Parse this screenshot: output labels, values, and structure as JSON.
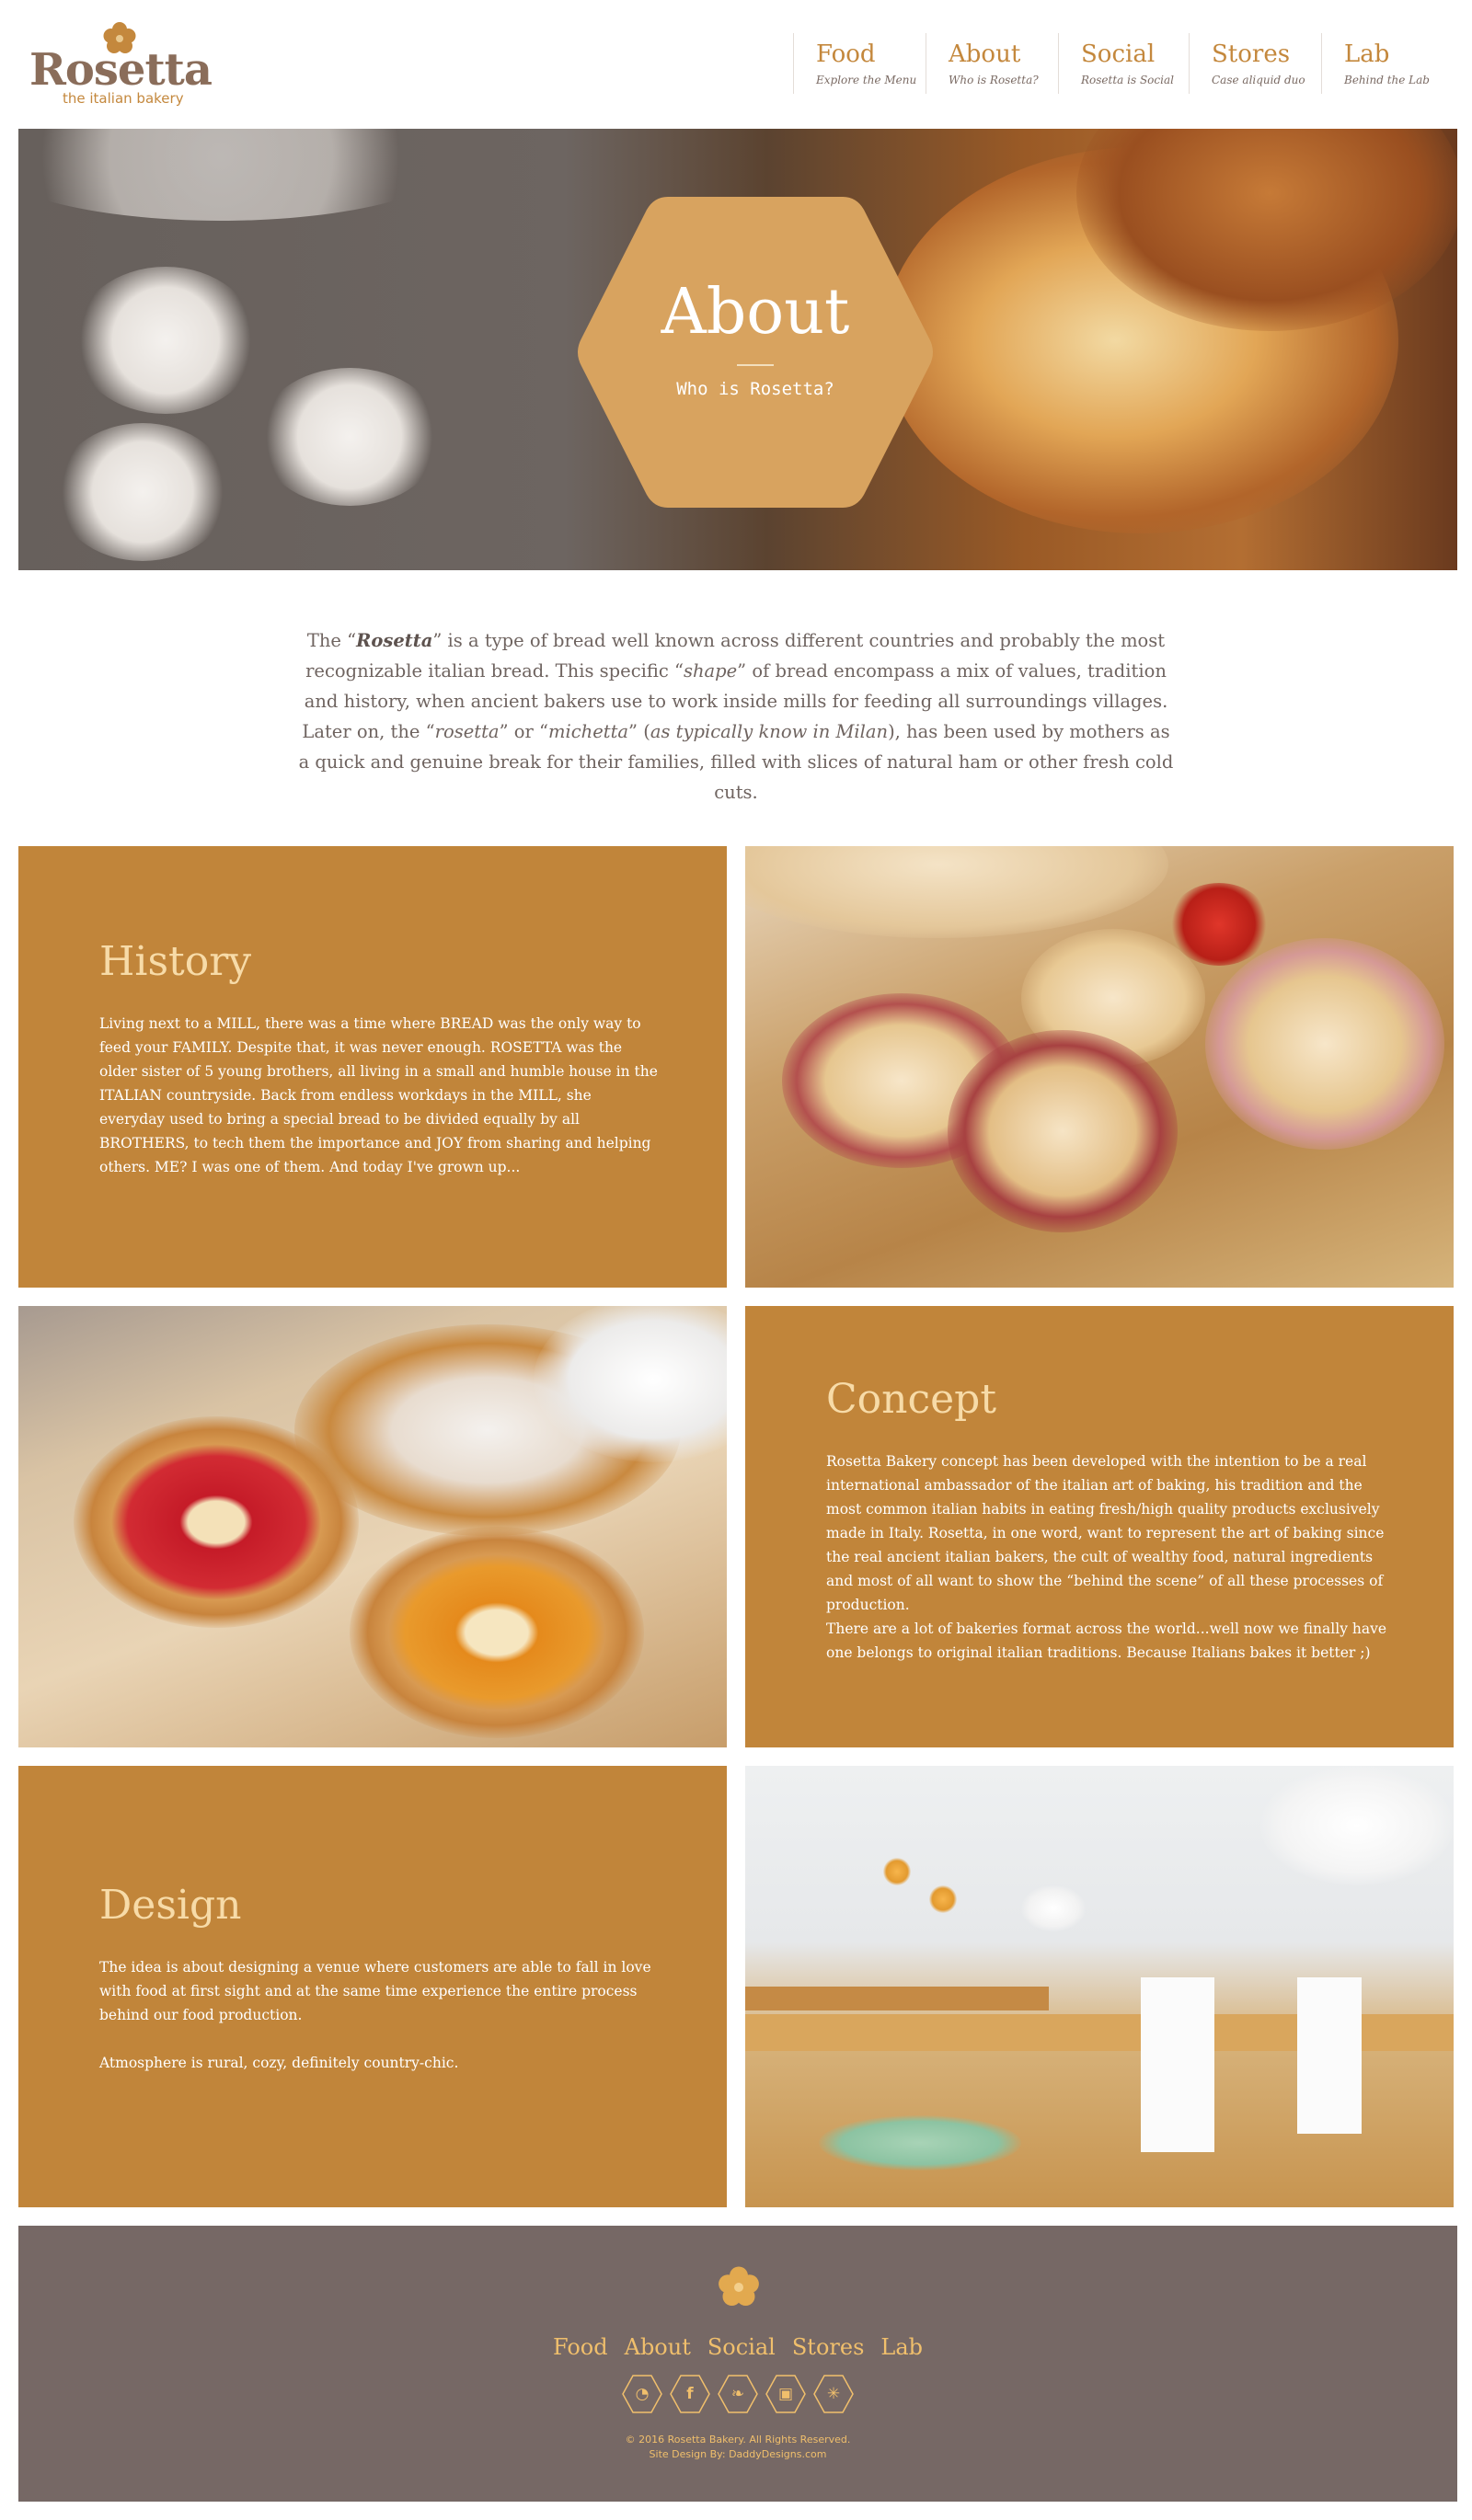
{
  "brand": {
    "name": "Rosetta",
    "tagline": "the italian bakery",
    "accent": "#c1853a",
    "title_color": "#f7dba8",
    "footer_bg": "#766865"
  },
  "nav": [
    {
      "label": "Food",
      "sub": "Explore the Menu"
    },
    {
      "label": "About",
      "sub": "Who is Rosetta?"
    },
    {
      "label": "Social",
      "sub": "Rosetta is Social"
    },
    {
      "label": "Stores",
      "sub": "Case aliquid duo"
    },
    {
      "label": "Lab",
      "sub": "Behind the Lab"
    }
  ],
  "hero": {
    "title": "About",
    "subtitle": "Who is Rosetta?"
  },
  "intro": {
    "p1": "The “",
    "rosetta": "Rosetta",
    "p2": "” is a type of bread well known across different countries and probably the most recognizable italian bread. This specific “",
    "shape": "shape",
    "p3": "” of bread encompass a mix of values, tradition and history, when ancient bakers use to work inside mills for feeding all surroundings villages. Later on, the “",
    "rosetta2": "rosetta",
    "p4": "” or “",
    "michetta": "michetta",
    "p5": "” (",
    "milan": "as typically know in Milan",
    "p6": "), has been used by mothers as a quick and genuine break for their families, filled with slices of natural ham or other fresh cold cuts."
  },
  "sections": {
    "history": {
      "title": "History",
      "body": "Living next to a MILL, there was a time where BREAD was the only way to feed your FAMILY. Despite that, it was never enough. ROSETTA was the older sister of 5 young brothers, all living in a small and humble house in the ITALIAN countryside. Back from endless workdays in the MILL, she everyday used to bring a special bread to be divided equally by all BROTHERS, to tech them the importance and JOY from sharing and helping others. ME? I was one of them. And today I've grown up..."
    },
    "concept": {
      "title": "Concept",
      "body1": "Rosetta Bakery concept has been developed with the intention to be a real international ambassador of the italian art of baking, his tradition and the most common italian habits in eating fresh/high quality products exclusively made in Italy.  Rosetta, in one word, want to represent the art of baking since the real ancient italian bakers, the cult of wealthy food, natural ingredients and most of all want to show the “behind the scene” of all these processes of production.",
      "body2": "There are a lot of bakeries format across the world...well now we finally have one belongs to original italian traditions. Because Italians bakes it better ;)"
    },
    "design": {
      "title": "Design",
      "body1": "The idea is about designing a venue where customers are able to fall in love with food at first sight and at the same time experience the entire process behind our food production.",
      "body2": "Atmosphere is rural, cozy, definitely country-chic."
    }
  },
  "footer": {
    "links": [
      "Food",
      "About",
      "Social",
      "Stores",
      "Lab"
    ],
    "social": [
      {
        "icon": "rss-icon",
        "glyph": "◔"
      },
      {
        "icon": "facebook-icon",
        "glyph": "f"
      },
      {
        "icon": "twitter-icon",
        "glyph": "❧"
      },
      {
        "icon": "instagram-icon",
        "glyph": "▣"
      },
      {
        "icon": "yelp-icon",
        "glyph": "✳"
      }
    ],
    "copyright": "© 2016 Rosetta Bakery. All Rights Reserved.",
    "credit": "Site Design By: DaddyDesigns.com"
  }
}
